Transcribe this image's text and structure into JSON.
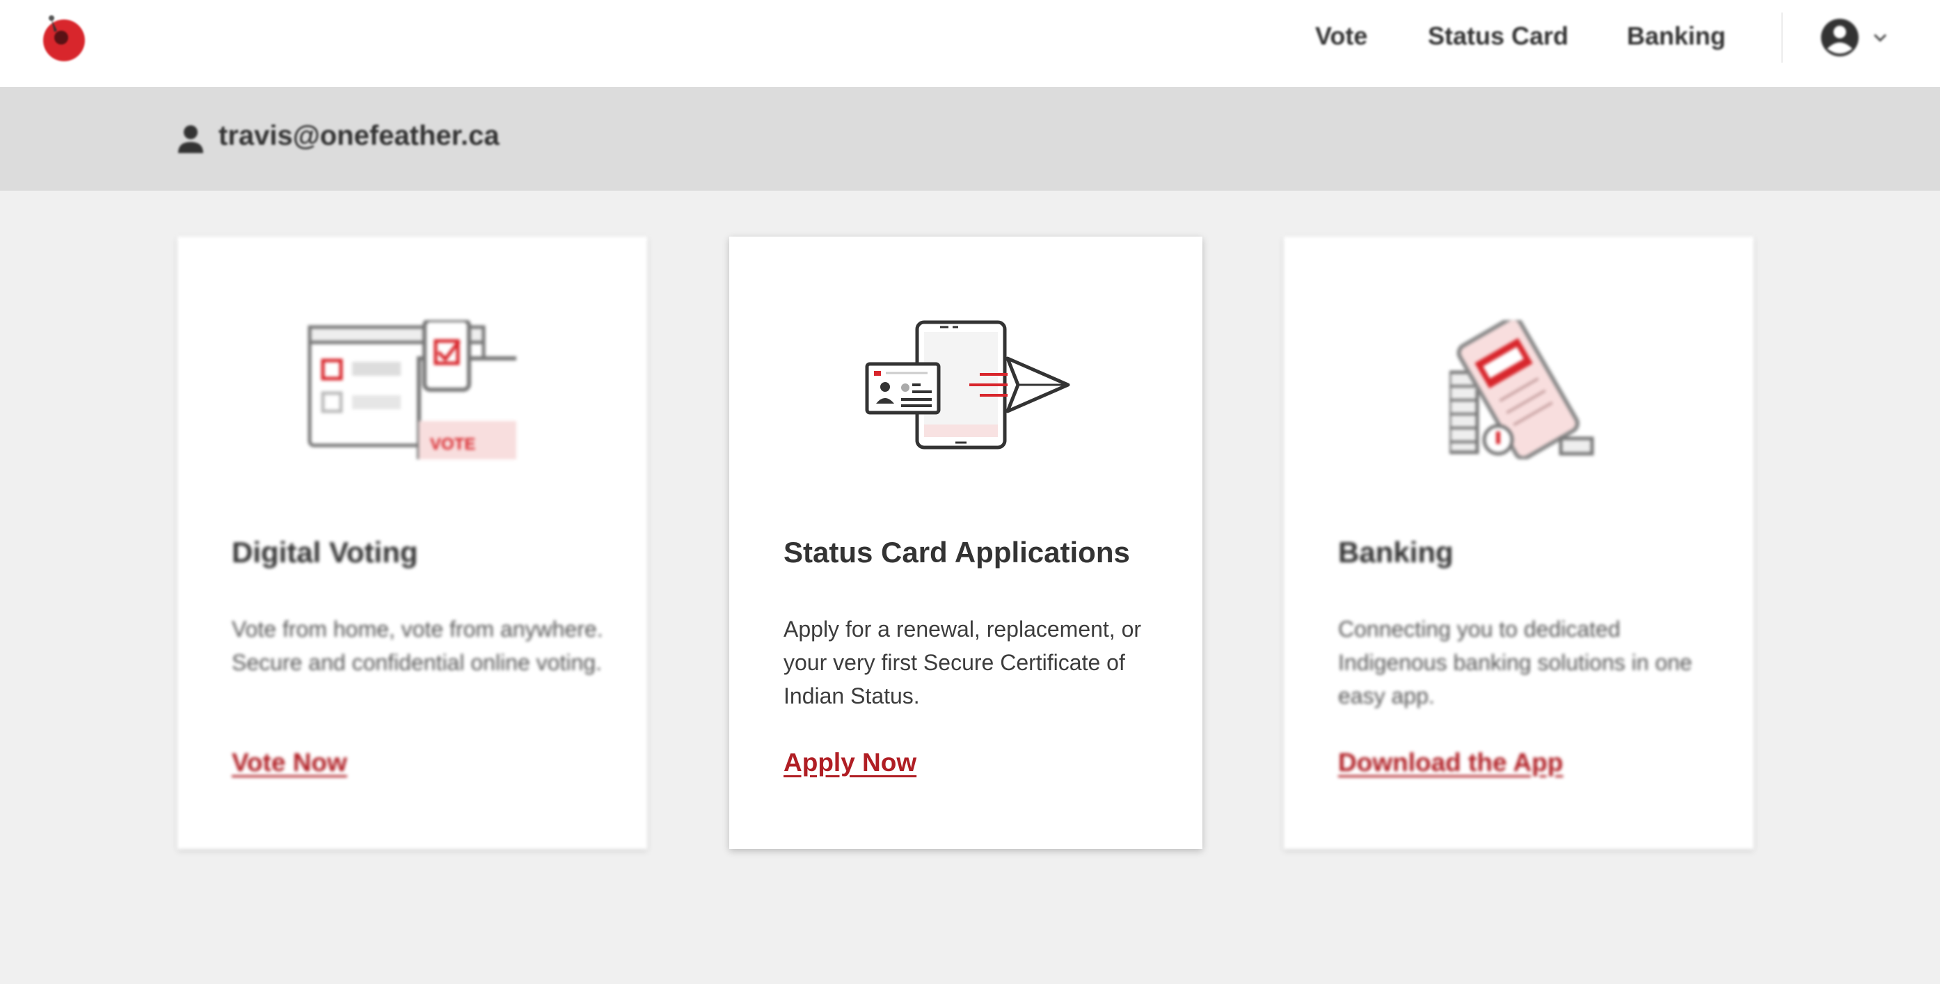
{
  "nav": {
    "links": [
      "Vote",
      "Status Card",
      "Banking"
    ]
  },
  "user": {
    "email": "travis@onefeather.ca"
  },
  "cards": [
    {
      "title": "Digital Voting",
      "description": "Vote from home, vote from anywhere. Secure and confidential online voting.",
      "link": "Vote Now",
      "illustration_text": "VOTE"
    },
    {
      "title": "Status Card Applications",
      "description": "Apply for a renewal, replacement, or your very first Secure Certificate of Indian Status.",
      "link": "Apply Now"
    },
    {
      "title": "Banking",
      "description": "Connecting you to dedicated Indigenous banking solutions in one easy app.",
      "link": "Download the App"
    }
  ],
  "icons": {
    "logo": "feather-logo-icon",
    "account": "account-circle-icon",
    "chevron": "chevron-down-icon",
    "user": "person-icon"
  },
  "colors": {
    "accent": "#b01e24",
    "brand_red": "#d8262c",
    "text": "#333333",
    "page_bg": "#f0f0f0",
    "userbar_bg": "#dcdcdc"
  }
}
